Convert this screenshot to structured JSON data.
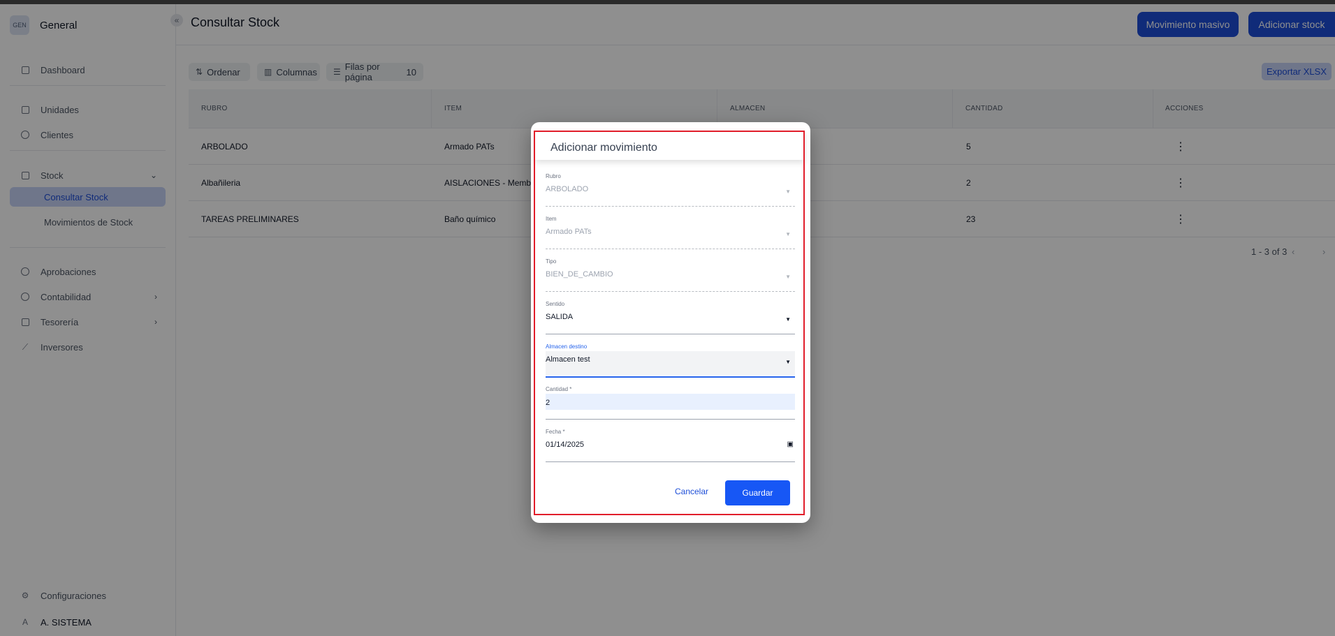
{
  "workspace": {
    "badge": "GEN",
    "name": "General"
  },
  "sidebar": {
    "collapse_icon": "«",
    "items": [
      {
        "label": "Dashboard",
        "icon": "grid-icon"
      },
      {
        "label": "Unidades",
        "icon": "calendar-icon"
      },
      {
        "label": "Clientes",
        "icon": "user-circle-icon"
      },
      {
        "label": "Stock",
        "icon": "inbox-icon"
      },
      {
        "label": "Consultar Stock"
      },
      {
        "label": "Movimientos de Stock"
      },
      {
        "label": "Aprobaciones",
        "icon": "plus-circle-icon"
      },
      {
        "label": "Contabilidad",
        "icon": "coins-icon"
      },
      {
        "label": "Tesorería",
        "icon": "bank-icon"
      },
      {
        "label": "Inversores",
        "icon": "chart-icon"
      }
    ],
    "footer": [
      {
        "label": "Configuraciones",
        "icon": "gear-icon"
      },
      {
        "label": "A. SISTEMA",
        "avatar": "A"
      }
    ]
  },
  "header": {
    "title": "Consultar Stock",
    "bulk_move_label": "Movimiento masivo",
    "add_stock_label": "Adicionar stock"
  },
  "toolbar": {
    "sort_label": "Ordenar",
    "columns_label": "Columnas",
    "rows_per_page_label": "Filas por página",
    "rows_per_page_value": "10",
    "export_label": "Exportar XLSX"
  },
  "table": {
    "columns": [
      "RUBRO",
      "ITEM",
      "ALMACEN",
      "CANTIDAD",
      "ACCIONES"
    ],
    "rows": [
      {
        "rubro": "ARBOLADO",
        "item": "Armado PATs",
        "almacen": "",
        "cantidad": "5"
      },
      {
        "rubro": "Albañileria",
        "item": "AISLACIONES - Membra",
        "almacen": "",
        "cantidad": "2"
      },
      {
        "rubro": "TAREAS PRELIMINARES",
        "item": "Baño químico",
        "almacen": "",
        "cantidad": "23"
      }
    ],
    "pagination": "1 - 3 of 3"
  },
  "modal": {
    "title": "Adicionar movimiento",
    "fields": {
      "rubro": {
        "label": "Rubro",
        "value": "ARBOLADO"
      },
      "item": {
        "label": "Item",
        "value": "Armado PATs"
      },
      "tipo": {
        "label": "Tipo",
        "value": "BIEN_DE_CAMBIO"
      },
      "sentido": {
        "label": "Sentido",
        "value": "SALIDA"
      },
      "almacen": {
        "label": "Almacen destino",
        "value": "Almacen test"
      },
      "cantidad": {
        "label": "Cantidad *",
        "value": "2"
      },
      "fecha": {
        "label": "Fecha *",
        "value": "01/14/2025"
      }
    },
    "cancel_label": "Cancelar",
    "save_label": "Guardar"
  },
  "colors": {
    "primary": "#1d4ed8",
    "highlight": "#e11d2a"
  }
}
